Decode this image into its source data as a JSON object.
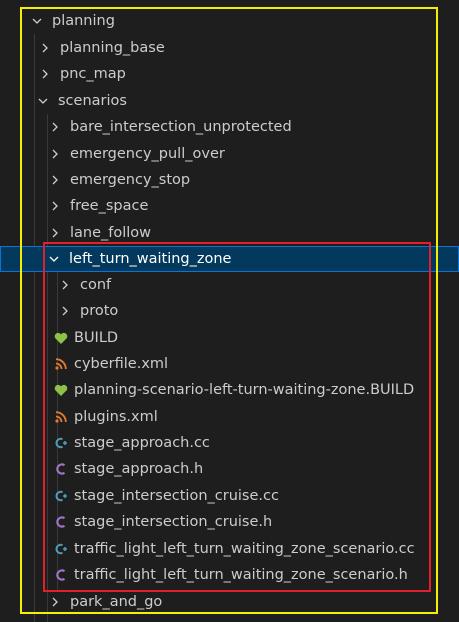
{
  "explorer": {
    "root": {
      "label": "planning",
      "expanded": true
    },
    "children": [
      {
        "label": "planning_base",
        "type": "folder",
        "expanded": false
      },
      {
        "label": "pnc_map",
        "type": "folder",
        "expanded": false
      },
      {
        "label": "scenarios",
        "type": "folder",
        "expanded": true
      }
    ],
    "scenarios": [
      {
        "label": "bare_intersection_unprotected",
        "expanded": false
      },
      {
        "label": "emergency_pull_over",
        "expanded": false
      },
      {
        "label": "emergency_stop",
        "expanded": false
      },
      {
        "label": "free_space",
        "expanded": false
      },
      {
        "label": "lane_follow",
        "expanded": false
      },
      {
        "label": "left_turn_waiting_zone",
        "expanded": true,
        "selected": true
      },
      {
        "label": "park_and_go",
        "expanded": false
      }
    ],
    "left_turn_waiting_zone": [
      {
        "label": "conf",
        "type": "folder",
        "icon": "chevron-right-icon"
      },
      {
        "label": "proto",
        "type": "folder",
        "icon": "chevron-right-icon"
      },
      {
        "label": "BUILD",
        "type": "bazel",
        "icon": "heart-icon"
      },
      {
        "label": "cyberfile.xml",
        "type": "xml",
        "icon": "rss-icon"
      },
      {
        "label": "planning-scenario-left-turn-waiting-zone.BUILD",
        "type": "bazel",
        "icon": "heart-icon"
      },
      {
        "label": "plugins.xml",
        "type": "xml",
        "icon": "rss-icon"
      },
      {
        "label": "stage_approach.cc",
        "type": "cpp",
        "icon": "cpp-icon",
        "glyph": "C+"
      },
      {
        "label": "stage_approach.h",
        "type": "header",
        "icon": "c-header-icon",
        "glyph": "C"
      },
      {
        "label": "stage_intersection_cruise.cc",
        "type": "cpp",
        "icon": "cpp-icon",
        "glyph": "C+"
      },
      {
        "label": "stage_intersection_cruise.h",
        "type": "header",
        "icon": "c-header-icon",
        "glyph": "C"
      },
      {
        "label": "traffic_light_left_turn_waiting_zone_scenario.cc",
        "type": "cpp",
        "icon": "cpp-icon",
        "glyph": "C+"
      },
      {
        "label": "traffic_light_left_turn_waiting_zone_scenario.h",
        "type": "header",
        "icon": "c-header-icon",
        "glyph": "C"
      }
    ],
    "colors": {
      "background": "#1e1e1e",
      "text": "#cccccc",
      "selection": "#04395e",
      "selection_border": "#0a74d6",
      "bazel_icon": "#8dc149",
      "xml_icon": "#e37933",
      "cpp_icon": "#519aba",
      "header_icon": "#a074c4",
      "annotation_outer": "#f5f000",
      "annotation_inner": "#e0202a"
    }
  }
}
